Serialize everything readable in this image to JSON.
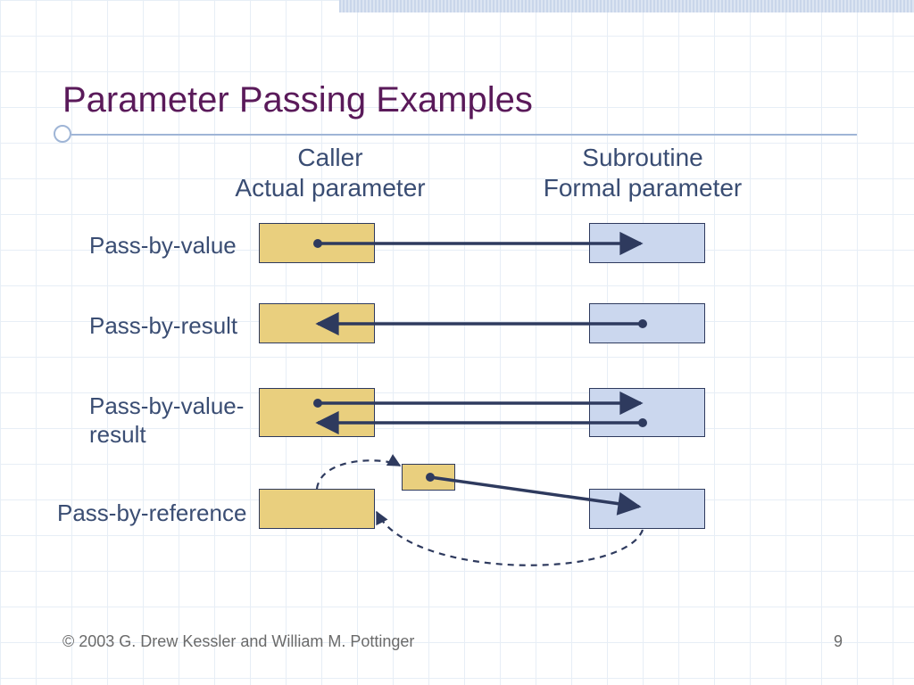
{
  "title": "Parameter Passing Examples",
  "columns": {
    "caller_line1": "Caller",
    "caller_line2": "Actual parameter",
    "sub_line1": "Subroutine",
    "sub_line2": "Formal parameter"
  },
  "rows": {
    "r1": "Pass-by-value",
    "r2": "Pass-by-result",
    "r3a": "Pass-by-value-",
    "r3b": "result",
    "r4": "Pass-by-reference"
  },
  "footer": {
    "copyright": "© 2003 G. Drew Kessler and William M. Pottinger",
    "page": "9"
  },
  "colors": {
    "arrow": "#2e3a5e",
    "gold": "#e9cf7e",
    "blue": "#cbd7ee"
  }
}
